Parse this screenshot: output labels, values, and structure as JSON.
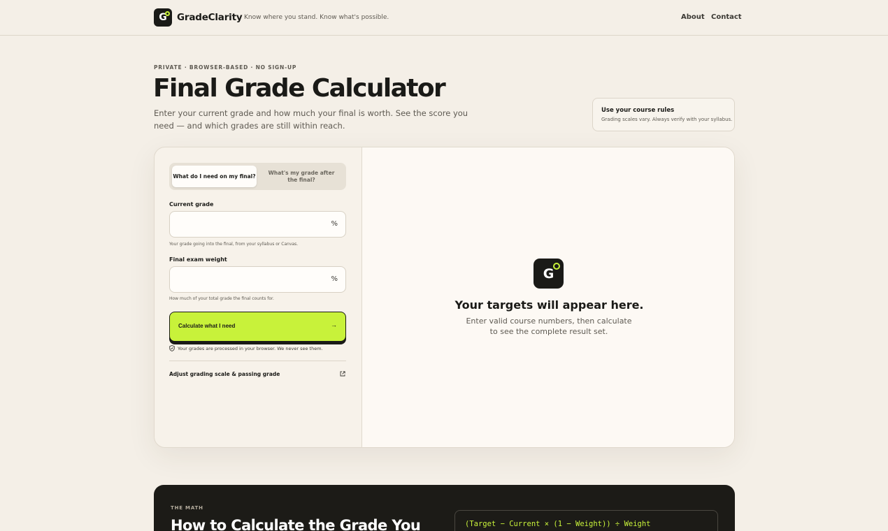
{
  "header": {
    "logo_letter": "G",
    "brand": "GradeClarity",
    "tagline": "Know where you stand. Know what's possible.",
    "nav": {
      "about": "About",
      "contact": "Contact"
    }
  },
  "hero": {
    "eyebrow": "PRIVATE · BROWSER-BASED · NO SIGN-UP",
    "title": "Final Grade Calculator",
    "subtitle": "Enter your current grade and how much your final is worth. See the score you need — and which grades are still within reach."
  },
  "rules_card": {
    "title": "Use your course rules",
    "note": "Grading scales vary. Always verify with your syllabus."
  },
  "calculator": {
    "tabs": [
      {
        "label": "What do I need on my final?",
        "active": true
      },
      {
        "label": "What's my grade after the final?",
        "active": false
      }
    ],
    "current_grade": {
      "label": "Current grade",
      "value": "",
      "placeholder": "",
      "unit": "%",
      "help": "Your grade going into the final, from your syllabus or Canvas."
    },
    "final_weight": {
      "label": "Final exam weight",
      "value": "",
      "placeholder": "",
      "unit": "%",
      "help": "How much of your total grade the final counts for."
    },
    "calculate_button": {
      "label": "Calculate what I need",
      "icon": "arrow-right-icon"
    },
    "privacy_note": "Your grades are processed in your browser. We never see them.",
    "adjust_link": "Adjust grading scale & passing grade"
  },
  "results": {
    "logo_letter": "G",
    "empty_title": "Your targets will appear here.",
    "empty_text": "Enter valid course numbers, then calculate to see the complete result set."
  },
  "math": {
    "eyebrow": "THE MATH",
    "title": "How to Calculate the Grade You",
    "formula": "(Target − Current × (1 − Weight)) ÷ Weight"
  },
  "colors": {
    "accent": "#c8f23a",
    "background": "#f4efe7",
    "dark": "#1a1a17"
  }
}
